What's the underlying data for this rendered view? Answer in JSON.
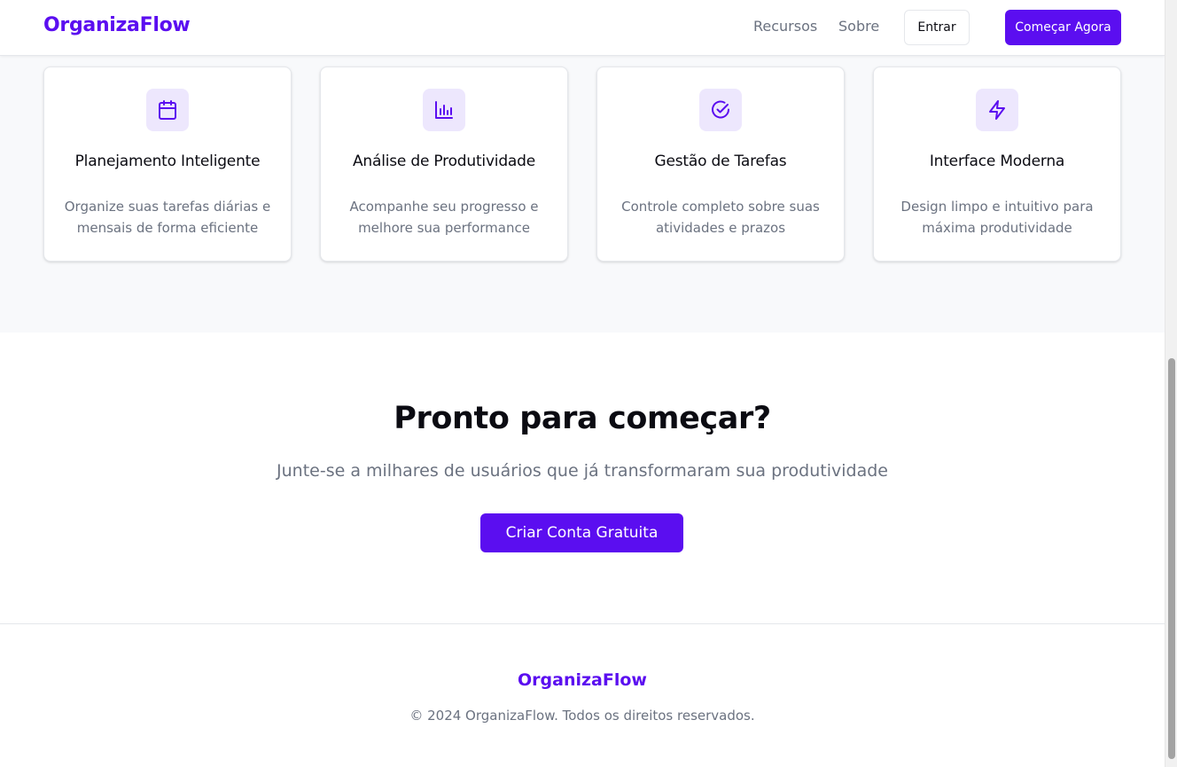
{
  "header": {
    "logo": "OrganizaFlow",
    "nav": [
      "Recursos",
      "Sobre"
    ],
    "login_label": "Entrar",
    "cta_label": "Começar Agora"
  },
  "features": {
    "cards": [
      {
        "icon": "calendar-icon",
        "title": "Planejamento Inteligente",
        "description": "Organize suas tarefas diárias e mensais de forma eficiente"
      },
      {
        "icon": "bar-chart-icon",
        "title": "Análise de Produtividade",
        "description": "Acompanhe seu progresso e melhore sua performance"
      },
      {
        "icon": "check-circle-icon",
        "title": "Gestão de Tarefas",
        "description": "Controle completo sobre suas atividades e prazos"
      },
      {
        "icon": "lightning-icon",
        "title": "Interface Moderna",
        "description": "Design limpo e intuitivo para máxima produtividade"
      }
    ]
  },
  "cta": {
    "title": "Pronto para começar?",
    "subtitle": "Junte-se a milhares de usuários que já transformaram sua produtividade",
    "button_label": "Criar Conta Gratuita"
  },
  "footer": {
    "logo": "OrganizaFlow",
    "copyright": "© 2024 OrganizaFlow. Todos os direitos reservados."
  },
  "colors": {
    "brand": "#5b0ef0",
    "icon_bg": "#ede7fd",
    "muted_text": "#6b7280",
    "section_bg": "#f8f9fb"
  }
}
